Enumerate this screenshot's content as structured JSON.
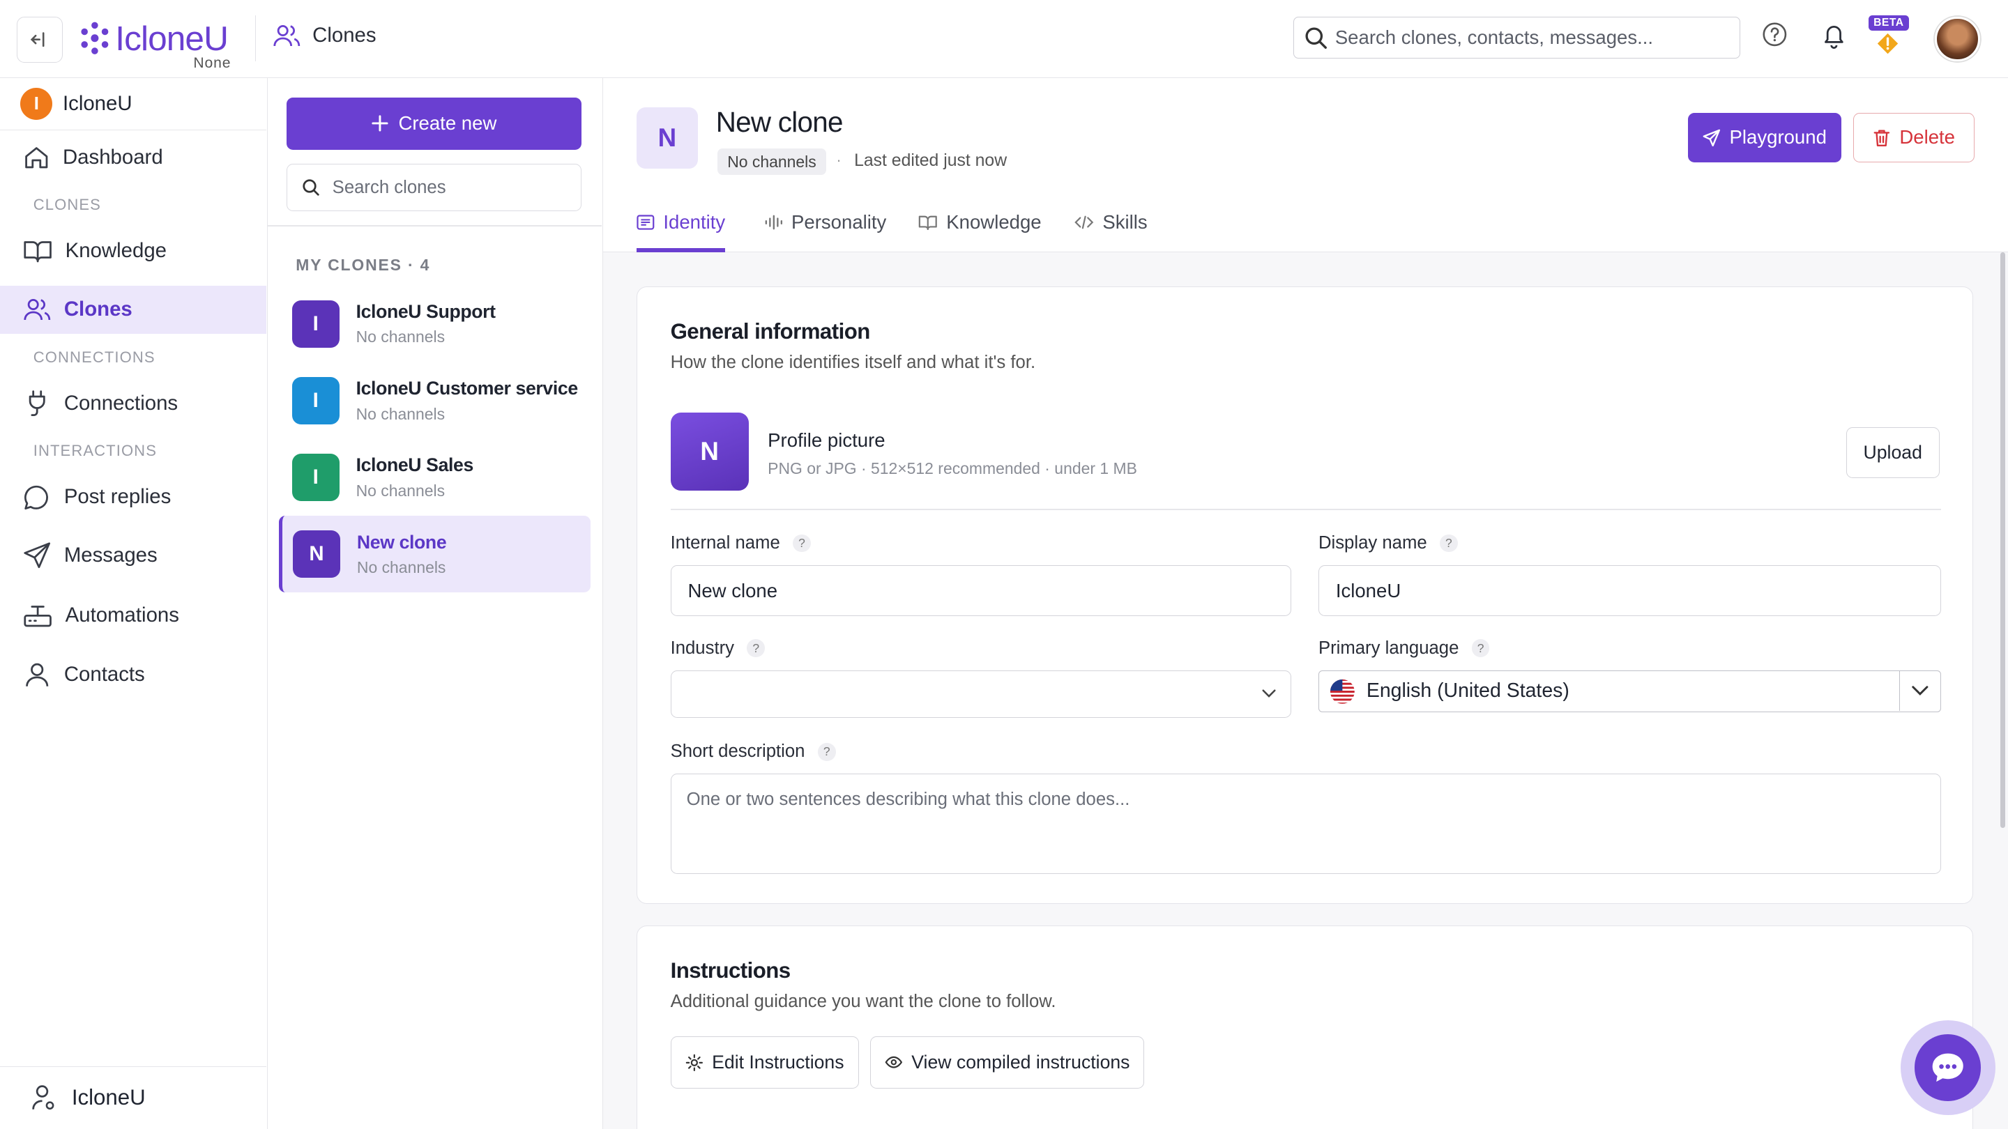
{
  "topbar": {
    "brand": "IcloneU",
    "brand_sub": "None",
    "crumb": "Clones",
    "search_placeholder": "Search clones, contacts, messages...",
    "beta_label": "BETA"
  },
  "sidebar": {
    "workspace": {
      "initial": "I",
      "name": "IcloneU"
    },
    "items": {
      "dashboard": "Dashboard",
      "sec_clones": "CLONES",
      "knowledge": "Knowledge",
      "clones": "Clones",
      "sec_connections": "CONNECTIONS",
      "connections": "Connections",
      "sec_interactions": "INTERACTIONS",
      "post_replies": "Post replies",
      "messages": "Messages",
      "automations": "Automations",
      "contacts": "Contacts"
    },
    "footer_user": "IcloneU"
  },
  "clones_panel": {
    "create_label": "Create new",
    "search_placeholder": "Search clones",
    "section_label": "MY CLONES · 4",
    "clones": [
      {
        "initial": "I",
        "name": "IcloneU Support",
        "sub": "No channels",
        "color": "#5b33b8"
      },
      {
        "initial": "I",
        "name": "IcloneU Customer service",
        "sub": "No channels",
        "color": "#1a8fd6"
      },
      {
        "initial": "I",
        "name": "IcloneU Sales",
        "sub": "No channels",
        "color": "#1f9d6a"
      },
      {
        "initial": "N",
        "name": "New clone",
        "sub": "No channels",
        "color": "#5b33b8"
      }
    ]
  },
  "main": {
    "initial": "N",
    "title": "New clone",
    "chip": "No channels",
    "separator": "·",
    "edited": "Last edited just now",
    "playground_label": "Playground",
    "delete_label": "Delete",
    "tabs": {
      "identity": "Identity",
      "personality": "Personality",
      "knowledge": "Knowledge",
      "skills": "Skills"
    },
    "general": {
      "title": "General information",
      "subtitle": "How the clone identifies itself and what it's for.",
      "pp_initial": "N",
      "pp_title": "Profile picture",
      "pp_sub": "PNG or JPG · 512×512 recommended · under 1 MB",
      "upload_label": "Upload",
      "internal_name_label": "Internal name",
      "internal_name_value": "New clone",
      "display_name_label": "Display name",
      "display_name_value": "IcloneU",
      "industry_label": "Industry",
      "industry_value": "",
      "primary_language_label": "Primary language",
      "primary_language_value": "English (United States)",
      "short_desc_label": "Short description",
      "short_desc_placeholder": "One or two sentences describing what this clone does...",
      "help_mark": "?"
    },
    "instructions": {
      "title": "Instructions",
      "subtitle": "Additional guidance you want the clone to follow.",
      "edit_label": "Edit Instructions",
      "view_label": "View compiled instructions"
    }
  },
  "colors": {
    "accent": "#6a3fd1",
    "danger": "#d6333a",
    "accent_soft": "#ece7fb"
  }
}
